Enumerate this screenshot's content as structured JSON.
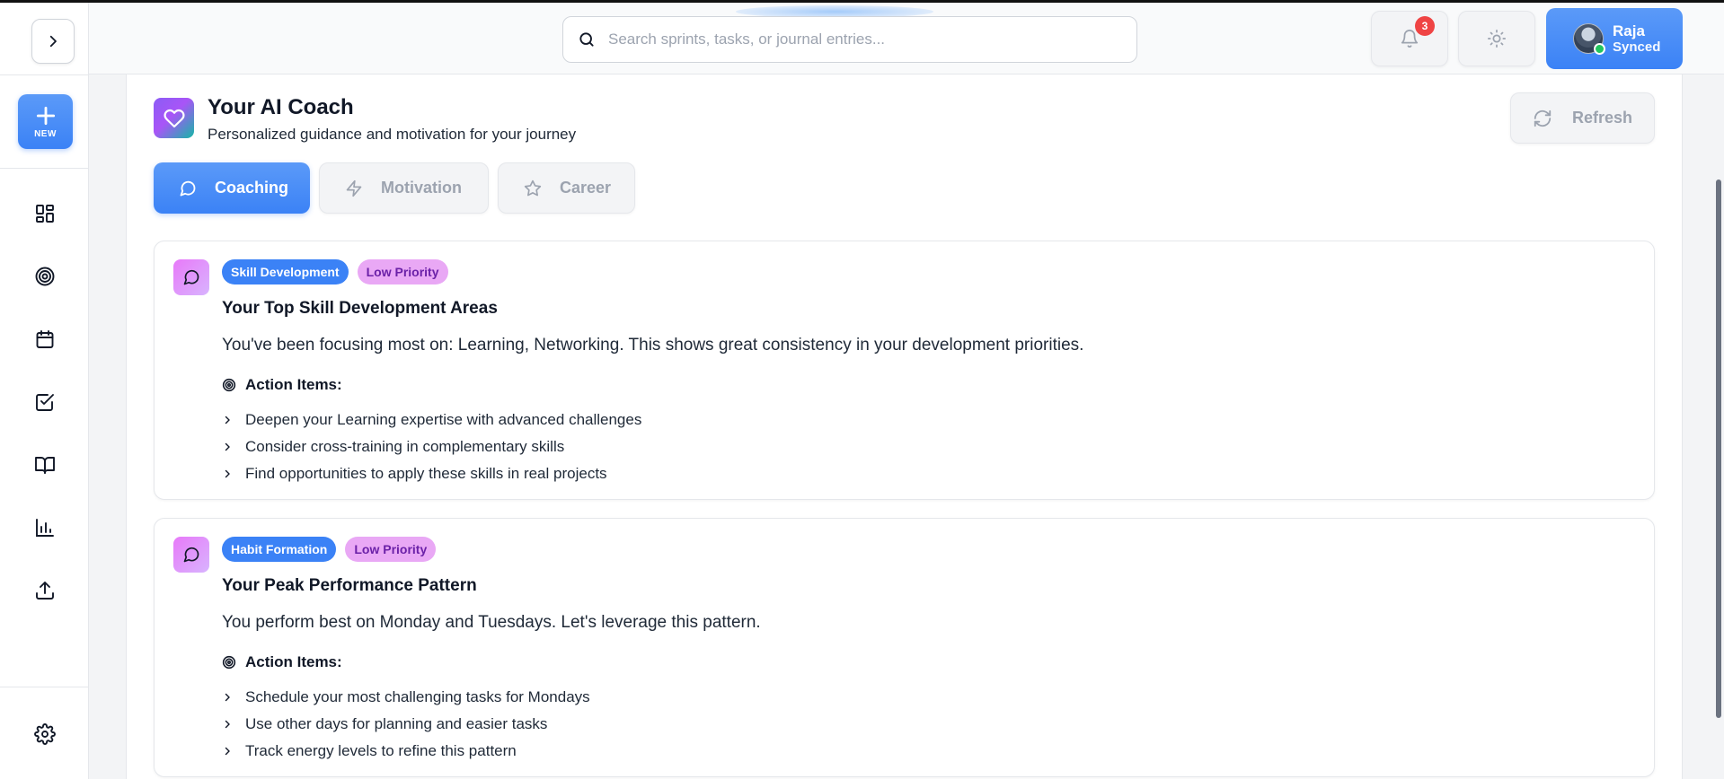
{
  "header": {
    "search_placeholder": "Search sprints, tasks, or journal entries...",
    "notifications_count": "3",
    "user": {
      "name": "Raja",
      "status": "Synced"
    }
  },
  "sidebar": {
    "new_label": "NEW",
    "items": [
      {
        "icon": "dashboard-icon"
      },
      {
        "icon": "target-icon"
      },
      {
        "icon": "calendar-icon"
      },
      {
        "icon": "checkbox-icon"
      },
      {
        "icon": "book-icon"
      },
      {
        "icon": "bar-chart-icon"
      },
      {
        "icon": "upload-icon"
      }
    ],
    "settings_icon": "gear-icon"
  },
  "coach": {
    "title": "Your AI Coach",
    "subtitle": "Personalized guidance and motivation for your journey",
    "refresh_label": "Refresh",
    "tabs": [
      {
        "label": "Coaching",
        "icon": "message-icon",
        "active": true
      },
      {
        "label": "Motivation",
        "icon": "lightning-icon",
        "active": false
      },
      {
        "label": "Career",
        "icon": "star-icon",
        "active": false
      }
    ]
  },
  "cards": [
    {
      "category": "Skill Development",
      "priority": "Low Priority",
      "title": "Your Top Skill Development Areas",
      "body": "You've been focusing most on: Learning, Networking. This shows great consistency in your development priorities.",
      "action_heading": "Action Items:",
      "actions": [
        "Deepen your Learning expertise with advanced challenges",
        "Consider cross-training in complementary skills",
        "Find opportunities to apply these skills in real projects"
      ]
    },
    {
      "category": "Habit Formation",
      "priority": "Low Priority",
      "title": "Your Peak Performance Pattern",
      "body": "You perform best on Monday and Tuesdays. Let's leverage this pattern.",
      "action_heading": "Action Items:",
      "actions": [
        "Schedule your most challenging tasks for Mondays",
        "Use other days for planning and easier tasks",
        "Track energy levels to refine this pattern"
      ]
    }
  ],
  "colors": {
    "accent": "#3b82f6",
    "priority_bg": "#e9a8f5",
    "badge": "#ef4444"
  }
}
